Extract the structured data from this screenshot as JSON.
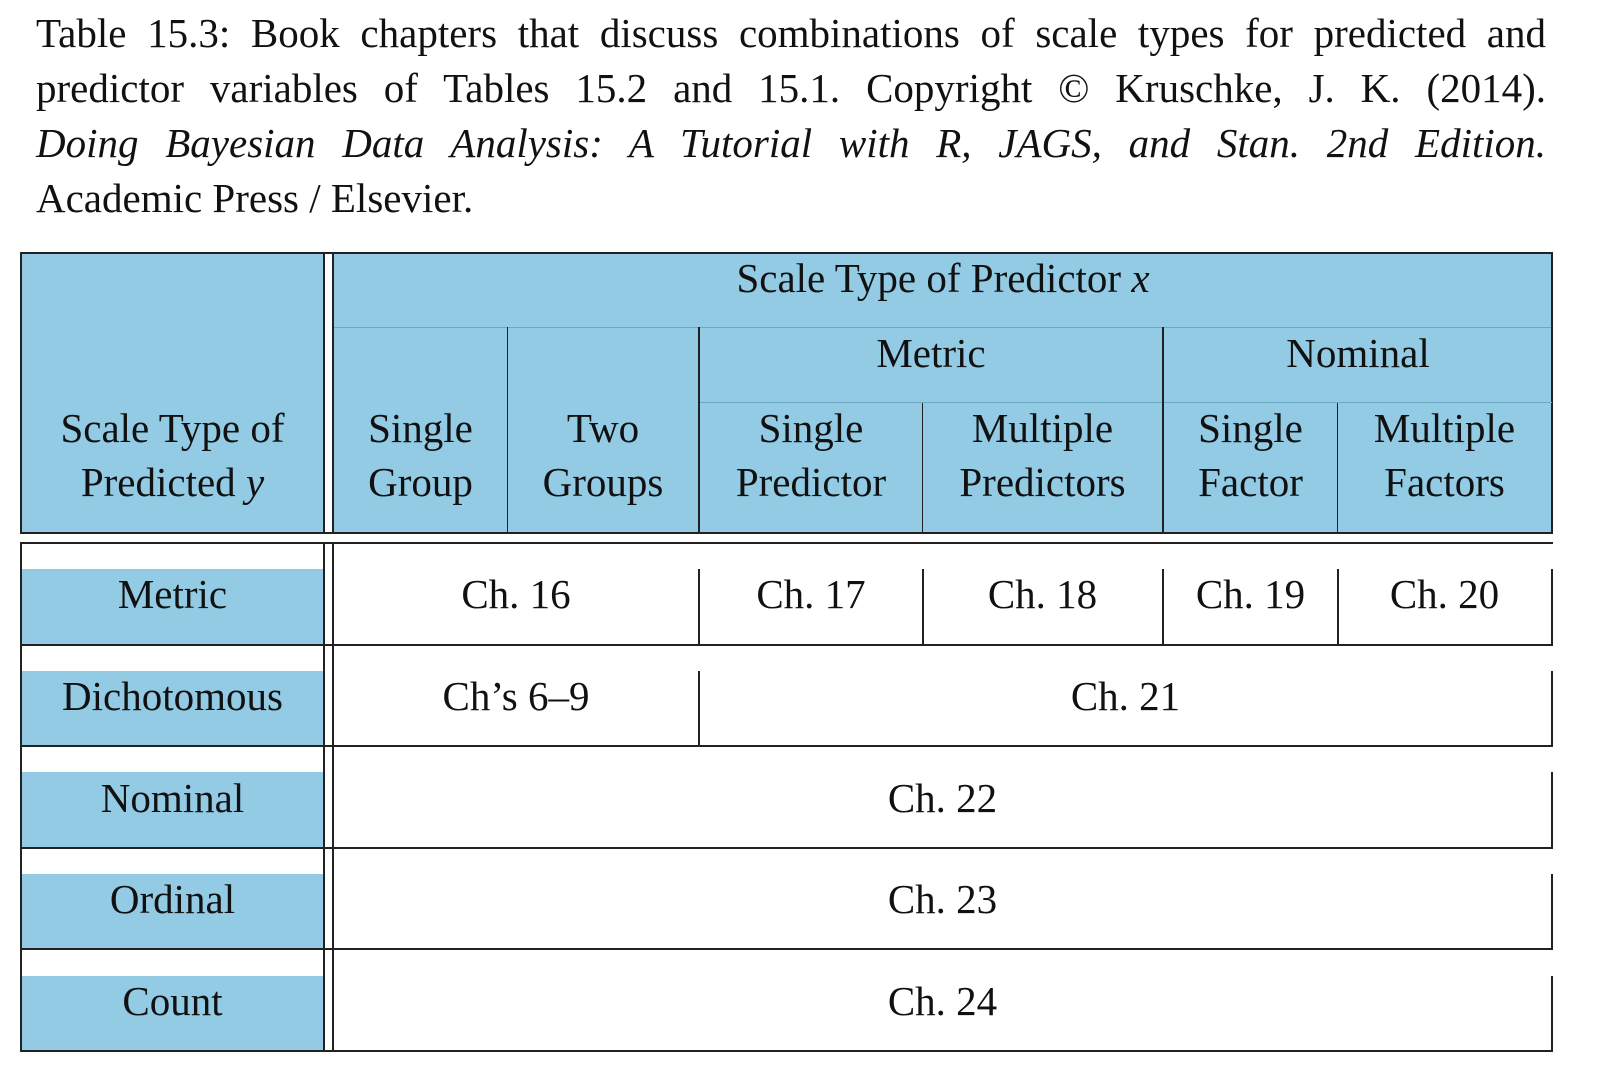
{
  "caption": {
    "line1": "Table 15.3: Book chapters that discuss combinations of scale types for predicted and",
    "line2": "predictor variables of Tables 15.2 and 15.1.  Copyright © Kruschke, J. K. (2014).",
    "line3": "Doing Bayesian Data Analysis:  A Tutorial with R, JAGS, and Stan.  2nd Edition.",
    "line4": "Academic Press / Elsevier."
  },
  "table": {
    "header_predictor": "Scale Type of Predictor",
    "header_predictor_var": "x",
    "group_metric": "Metric",
    "group_nominal": "Nominal",
    "header_predicted_l1": "Scale Type of",
    "header_predicted_l2": "Predicted",
    "header_predicted_var": "y",
    "cols": [
      {
        "l1": "Single",
        "l2": "Group"
      },
      {
        "l1": "Two",
        "l2": "Groups"
      },
      {
        "l1": "Single",
        "l2": "Predictor"
      },
      {
        "l1": "Multiple",
        "l2": "Predictors"
      },
      {
        "l1": "Single",
        "l2": "Factor"
      },
      {
        "l1": "Multiple",
        "l2": "Factors"
      }
    ],
    "rows": [
      {
        "label": "Metric",
        "cells": [
          "Ch. 16",
          "Ch. 17",
          "Ch. 18",
          "Ch. 19",
          "Ch. 20"
        ]
      },
      {
        "label": "Dichotomous",
        "cells": [
          "Ch’s 6–9",
          "Ch. 21"
        ]
      },
      {
        "label": "Nominal",
        "cells": [
          "Ch. 22"
        ]
      },
      {
        "label": "Ordinal",
        "cells": [
          "Ch. 23"
        ]
      },
      {
        "label": "Count",
        "cells": [
          "Ch. 24"
        ]
      }
    ]
  },
  "colors": {
    "header_fill": "#93cbe5",
    "rule": "#222222"
  }
}
